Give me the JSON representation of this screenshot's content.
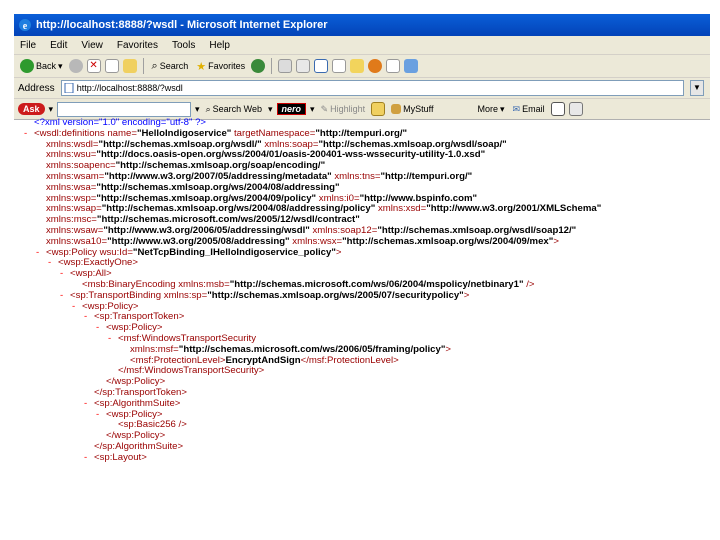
{
  "window": {
    "title": "http://localhost:8888/?wsdl - Microsoft Internet Explorer"
  },
  "menu": [
    "File",
    "Edit",
    "View",
    "Favorites",
    "Tools",
    "Help"
  ],
  "toolbar": {
    "back": "Back",
    "search": "Search",
    "favorites": "Favorites"
  },
  "address": {
    "label": "Address",
    "url": "http://localhost:8888/?wsdl"
  },
  "askbar": {
    "logo": "Ask",
    "search_web": "Search Web",
    "nero": "nero",
    "highlight": "Highlight",
    "myStuff": "MyStuff",
    "more": "More",
    "email": "Email"
  },
  "xml_lines": [
    {
      "indent": 0,
      "minus": false,
      "parts": [
        [
          "pi",
          "<?xml version=\"1.0\" encoding=\"utf-8\" ?>"
        ]
      ]
    },
    {
      "indent": 0,
      "minus": true,
      "parts": [
        [
          "tag",
          "<wsdl:definitions name="
        ],
        [
          "val",
          "\"HelloIndigoservice\""
        ],
        [
          "attr",
          " targetNamespace="
        ],
        [
          "val",
          "\"http://tempuri.org/\""
        ]
      ]
    },
    {
      "indent": 1,
      "minus": false,
      "parts": [
        [
          "attr",
          "xmlns:wsdl="
        ],
        [
          "val",
          "\"http://schemas.xmlsoap.org/wsdl/\""
        ],
        [
          "attr",
          " xmlns:soap="
        ],
        [
          "val",
          "\"http://schemas.xmlsoap.org/wsdl/soap/\""
        ]
      ]
    },
    {
      "indent": 1,
      "minus": false,
      "parts": [
        [
          "attr",
          "xmlns:wsu="
        ],
        [
          "val",
          "\"http://docs.oasis-open.org/wss/2004/01/oasis-200401-wss-wssecurity-utility-1.0.xsd\""
        ]
      ]
    },
    {
      "indent": 1,
      "minus": false,
      "parts": [
        [
          "attr",
          "xmlns:soapenc="
        ],
        [
          "val",
          "\"http://schemas.xmlsoap.org/soap/encoding/\""
        ]
      ]
    },
    {
      "indent": 1,
      "minus": false,
      "parts": [
        [
          "attr",
          "xmlns:wsam="
        ],
        [
          "val",
          "\"http://www.w3.org/2007/05/addressing/metadata\""
        ],
        [
          "attr",
          " xmlns:tns="
        ],
        [
          "val",
          "\"http://tempuri.org/\""
        ]
      ]
    },
    {
      "indent": 1,
      "minus": false,
      "parts": [
        [
          "attr",
          "xmlns:wsa="
        ],
        [
          "val",
          "\"http://schemas.xmlsoap.org/ws/2004/08/addressing\""
        ]
      ]
    },
    {
      "indent": 1,
      "minus": false,
      "parts": [
        [
          "attr",
          "xmlns:wsp="
        ],
        [
          "val",
          "\"http://schemas.xmlsoap.org/ws/2004/09/policy\""
        ],
        [
          "attr",
          " xmlns:i0="
        ],
        [
          "val",
          "\"http://www.bspinfo.com\""
        ]
      ]
    },
    {
      "indent": 1,
      "minus": false,
      "parts": [
        [
          "attr",
          "xmlns:wsap="
        ],
        [
          "val",
          "\"http://schemas.xmlsoap.org/ws/2004/08/addressing/policy\""
        ],
        [
          "attr",
          " xmlns:xsd="
        ],
        [
          "val",
          "\"http://www.w3.org/2001/XMLSchema\""
        ]
      ]
    },
    {
      "indent": 1,
      "minus": false,
      "parts": [
        [
          "attr",
          "xmlns:msc="
        ],
        [
          "val",
          "\"http://schemas.microsoft.com/ws/2005/12/wsdl/contract\""
        ]
      ]
    },
    {
      "indent": 1,
      "minus": false,
      "parts": [
        [
          "attr",
          "xmlns:wsaw="
        ],
        [
          "val",
          "\"http://www.w3.org/2006/05/addressing/wsdl\""
        ],
        [
          "attr",
          " xmlns:soap12="
        ],
        [
          "val",
          "\"http://schemas.xmlsoap.org/wsdl/soap12/\""
        ]
      ]
    },
    {
      "indent": 1,
      "minus": false,
      "parts": [
        [
          "attr",
          "xmlns:wsa10="
        ],
        [
          "val",
          "\"http://www.w3.org/2005/08/addressing\""
        ],
        [
          "attr",
          " xmlns:wsx="
        ],
        [
          "val",
          "\"http://schemas.xmlsoap.org/ws/2004/09/mex\""
        ],
        [
          "tag",
          ">"
        ]
      ]
    },
    {
      "indent": 1,
      "minus": true,
      "parts": [
        [
          "tag",
          "<wsp:Policy wsu:Id="
        ],
        [
          "val",
          "\"NetTcpBinding_IHelloIndigoservice_policy\""
        ],
        [
          "tag",
          ">"
        ]
      ]
    },
    {
      "indent": 2,
      "minus": true,
      "parts": [
        [
          "tag",
          "<wsp:ExactlyOne>"
        ]
      ]
    },
    {
      "indent": 3,
      "minus": true,
      "parts": [
        [
          "tag",
          "<wsp:All>"
        ]
      ]
    },
    {
      "indent": 4,
      "minus": false,
      "parts": [
        [
          "tag",
          "<msb:BinaryEncoding xmlns:msb="
        ],
        [
          "val",
          "\"http://schemas.microsoft.com/ws/06/2004/mspolicy/netbinary1\""
        ],
        [
          "tag",
          " />"
        ]
      ]
    },
    {
      "indent": 3,
      "minus": true,
      "parts": [
        [
          "tag",
          "<sp:TransportBinding xmlns:sp="
        ],
        [
          "val",
          "\"http://schemas.xmlsoap.org/ws/2005/07/securitypolicy\""
        ],
        [
          "tag",
          ">"
        ]
      ]
    },
    {
      "indent": 4,
      "minus": true,
      "parts": [
        [
          "tag",
          "<wsp:Policy>"
        ]
      ]
    },
    {
      "indent": 5,
      "minus": true,
      "parts": [
        [
          "tag",
          "<sp:TransportToken>"
        ]
      ]
    },
    {
      "indent": 6,
      "minus": true,
      "parts": [
        [
          "tag",
          "<wsp:Policy>"
        ]
      ]
    },
    {
      "indent": 7,
      "minus": true,
      "parts": [
        [
          "tag",
          "<msf:WindowsTransportSecurity"
        ]
      ]
    },
    {
      "indent": 8,
      "minus": false,
      "parts": [
        [
          "attr",
          "xmlns:msf="
        ],
        [
          "val",
          "\"http://schemas.microsoft.com/ws/2006/05/framing/policy\""
        ],
        [
          "tag",
          ">"
        ]
      ]
    },
    {
      "indent": 8,
      "minus": false,
      "parts": [
        [
          "tag",
          "<msf:ProtectionLevel>"
        ],
        [
          "txt",
          "EncryptAndSign"
        ],
        [
          "tag",
          "</msf:ProtectionLevel>"
        ]
      ]
    },
    {
      "indent": 7,
      "minus": false,
      "parts": [
        [
          "tag",
          "</msf:WindowsTransportSecurity>"
        ]
      ]
    },
    {
      "indent": 6,
      "minus": false,
      "parts": [
        [
          "tag",
          "</wsp:Policy>"
        ]
      ]
    },
    {
      "indent": 5,
      "minus": false,
      "parts": [
        [
          "tag",
          "</sp:TransportToken>"
        ]
      ]
    },
    {
      "indent": 5,
      "minus": true,
      "parts": [
        [
          "tag",
          "<sp:AlgorithmSuite>"
        ]
      ]
    },
    {
      "indent": 6,
      "minus": true,
      "parts": [
        [
          "tag",
          "<wsp:Policy>"
        ]
      ]
    },
    {
      "indent": 7,
      "minus": false,
      "parts": [
        [
          "tag",
          "<sp:Basic256 />"
        ]
      ]
    },
    {
      "indent": 6,
      "minus": false,
      "parts": [
        [
          "tag",
          "</wsp:Policy>"
        ]
      ]
    },
    {
      "indent": 5,
      "minus": false,
      "parts": [
        [
          "tag",
          "</sp:AlgorithmSuite>"
        ]
      ]
    },
    {
      "indent": 5,
      "minus": true,
      "parts": [
        [
          "tag",
          "<sp:Layout>"
        ]
      ]
    }
  ]
}
